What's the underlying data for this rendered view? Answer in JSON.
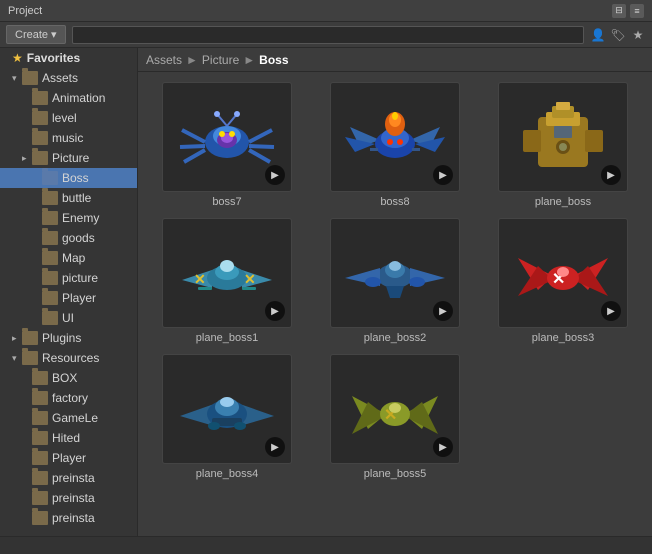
{
  "window": {
    "title": "Project"
  },
  "toolbar": {
    "create_label": "Create",
    "search_placeholder": "",
    "icons": [
      "person-icon",
      "tag-icon",
      "star-icon"
    ]
  },
  "breadcrumb": {
    "items": [
      "Assets",
      "Picture",
      "Boss"
    ]
  },
  "sidebar": {
    "favorites_label": "Favorites",
    "sections": [
      {
        "name": "Assets",
        "items": [
          {
            "label": "Animation",
            "indent": 2,
            "has_arrow": false
          },
          {
            "label": "level",
            "indent": 2,
            "has_arrow": false
          },
          {
            "label": "music",
            "indent": 2,
            "has_arrow": false
          },
          {
            "label": "Picture",
            "indent": 2,
            "has_arrow": true,
            "expanded": true
          },
          {
            "label": "Boss",
            "indent": 3,
            "has_arrow": false,
            "selected": true
          },
          {
            "label": "buttle",
            "indent": 3,
            "has_arrow": false
          },
          {
            "label": "Enemy",
            "indent": 3,
            "has_arrow": false
          },
          {
            "label": "goods",
            "indent": 3,
            "has_arrow": false
          },
          {
            "label": "Map",
            "indent": 3,
            "has_arrow": false
          },
          {
            "label": "picture",
            "indent": 3,
            "has_arrow": false
          },
          {
            "label": "Player",
            "indent": 3,
            "has_arrow": false
          },
          {
            "label": "UI",
            "indent": 3,
            "has_arrow": false
          }
        ]
      },
      {
        "name": "Plugins",
        "items": []
      },
      {
        "name": "Resources",
        "items": [
          {
            "label": "BOX",
            "indent": 2,
            "has_arrow": false
          },
          {
            "label": "factory",
            "indent": 2,
            "has_arrow": false
          },
          {
            "label": "GameLe",
            "indent": 2,
            "has_arrow": false
          },
          {
            "label": "Hited",
            "indent": 2,
            "has_arrow": false
          },
          {
            "label": "Player",
            "indent": 2,
            "has_arrow": false
          },
          {
            "label": "preinsta",
            "indent": 2,
            "has_arrow": false
          },
          {
            "label": "preinsta",
            "indent": 2,
            "has_arrow": false
          },
          {
            "label": "preinsta",
            "indent": 2,
            "has_arrow": false
          }
        ]
      }
    ]
  },
  "assets": [
    {
      "id": "boss7",
      "label": "boss7",
      "color1": "#3a6ab0",
      "color2": "#8844cc"
    },
    {
      "id": "boss8",
      "label": "boss8",
      "color1": "#e07820",
      "color2": "#3a6ab0"
    },
    {
      "id": "plane_boss",
      "label": "plane_boss",
      "color1": "#c8a020",
      "color2": "#7a7a7a"
    },
    {
      "id": "plane_boss1",
      "label": "plane_boss1",
      "color1": "#4a9abf",
      "color2": "#e0b040"
    },
    {
      "id": "plane_boss2",
      "label": "plane_boss2",
      "color1": "#4a70a0",
      "color2": "#6090c0"
    },
    {
      "id": "plane_boss3",
      "label": "plane_boss3",
      "color1": "#c03030",
      "color2": "#ffffff"
    },
    {
      "id": "plane_boss4",
      "label": "plane_boss4",
      "color1": "#3a70a0",
      "color2": "#5090c0"
    },
    {
      "id": "plane_boss5",
      "label": "plane_boss5",
      "color1": "#8a9a30",
      "color2": "#c0b040"
    }
  ]
}
